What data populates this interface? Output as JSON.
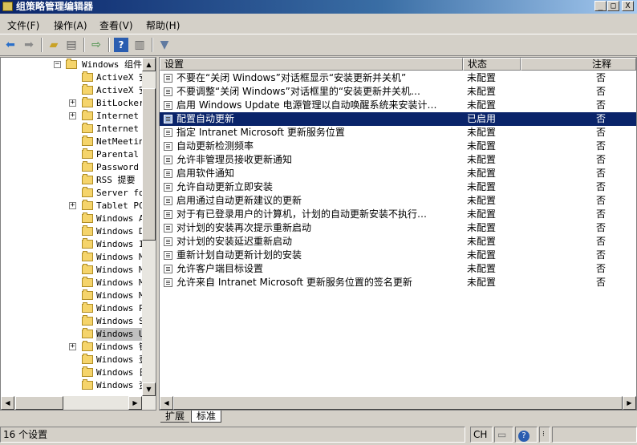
{
  "window": {
    "title": "组策略管理编辑器",
    "minimize_label": "_",
    "maximize_label": "□",
    "close_label": "X"
  },
  "menu": [
    "文件(F)",
    "操作(A)",
    "查看(V)",
    "帮助(H)"
  ],
  "toolbar": {
    "icons": [
      "back-arrow-icon",
      "forward-arrow-icon",
      "up-folder-icon",
      "show-hide-tree-icon",
      "export-list-icon",
      "help-icon",
      "properties-pane-icon",
      "filter-icon"
    ]
  },
  "tree": {
    "root": {
      "label": "Windows 组件",
      "expander": "−"
    },
    "items": [
      {
        "label": "ActiveX 安",
        "expander": ""
      },
      {
        "label": "ActiveX 安",
        "expander": ""
      },
      {
        "label": "BitLocker",
        "expander": "+"
      },
      {
        "label": "Internet I",
        "expander": "+"
      },
      {
        "label": "Internet I",
        "expander": ""
      },
      {
        "label": "NetMeeting",
        "expander": ""
      },
      {
        "label": "Parental C",
        "expander": ""
      },
      {
        "label": "Password S",
        "expander": ""
      },
      {
        "label": "RSS 提要",
        "expander": ""
      },
      {
        "label": "Server for",
        "expander": ""
      },
      {
        "label": "Tablet PC",
        "expander": "+"
      },
      {
        "label": "Windows A",
        "expander": ""
      },
      {
        "label": "Windows D",
        "expander": ""
      },
      {
        "label": "Windows I",
        "expander": ""
      },
      {
        "label": "Windows M",
        "expander": ""
      },
      {
        "label": "Windows M",
        "expander": ""
      },
      {
        "label": "Windows M",
        "expander": ""
      },
      {
        "label": "Windows M",
        "expander": ""
      },
      {
        "label": "Windows P",
        "expander": ""
      },
      {
        "label": "Windows S",
        "expander": ""
      },
      {
        "label": "Windows U",
        "expander": "",
        "selected": true
      },
      {
        "label": "Windows 错",
        "expander": "+"
      },
      {
        "label": "Windows 登",
        "expander": ""
      },
      {
        "label": "Windows 日",
        "expander": ""
      },
      {
        "label": "Windows 资",
        "expander": ""
      }
    ]
  },
  "list": {
    "headers": {
      "setting": "设置",
      "state": "状态",
      "comment": "注释"
    },
    "rows": [
      {
        "setting": "不要在“关闭 Windows”对话框显示“安装更新并关机”",
        "state": "未配置",
        "comment": "否"
      },
      {
        "setting": "不要调整“关闭 Windows”对话框里的“安装更新并关机…",
        "state": "未配置",
        "comment": "否"
      },
      {
        "setting": "启用 Windows Update 电源管理以自动唤醒系统来安装计…",
        "state": "未配置",
        "comment": "否"
      },
      {
        "setting": "配置自动更新",
        "state": "已启用",
        "comment": "否",
        "selected": true
      },
      {
        "setting": "指定 Intranet Microsoft 更新服务位置",
        "state": "未配置",
        "comment": "否"
      },
      {
        "setting": "自动更新检测频率",
        "state": "未配置",
        "comment": "否"
      },
      {
        "setting": "允许非管理员接收更新通知",
        "state": "未配置",
        "comment": "否"
      },
      {
        "setting": "启用软件通知",
        "state": "未配置",
        "comment": "否"
      },
      {
        "setting": "允许自动更新立即安装",
        "state": "未配置",
        "comment": "否"
      },
      {
        "setting": "启用通过自动更新建议的更新",
        "state": "未配置",
        "comment": "否"
      },
      {
        "setting": "对于有已登录用户的计算机，计划的自动更新安装不执行…",
        "state": "未配置",
        "comment": "否"
      },
      {
        "setting": "对计划的安装再次提示重新启动",
        "state": "未配置",
        "comment": "否"
      },
      {
        "setting": "对计划的安装延迟重新启动",
        "state": "未配置",
        "comment": "否"
      },
      {
        "setting": "重新计划自动更新计划的安装",
        "state": "未配置",
        "comment": "否"
      },
      {
        "setting": "允许客户端目标设置",
        "state": "未配置",
        "comment": "否"
      },
      {
        "setting": "允许来自 Intranet Microsoft 更新服务位置的签名更新",
        "state": "未配置",
        "comment": "否"
      }
    ]
  },
  "tabs": [
    "扩展",
    "标准"
  ],
  "status": {
    "count_text": "16 个设置",
    "ime": "CH"
  }
}
